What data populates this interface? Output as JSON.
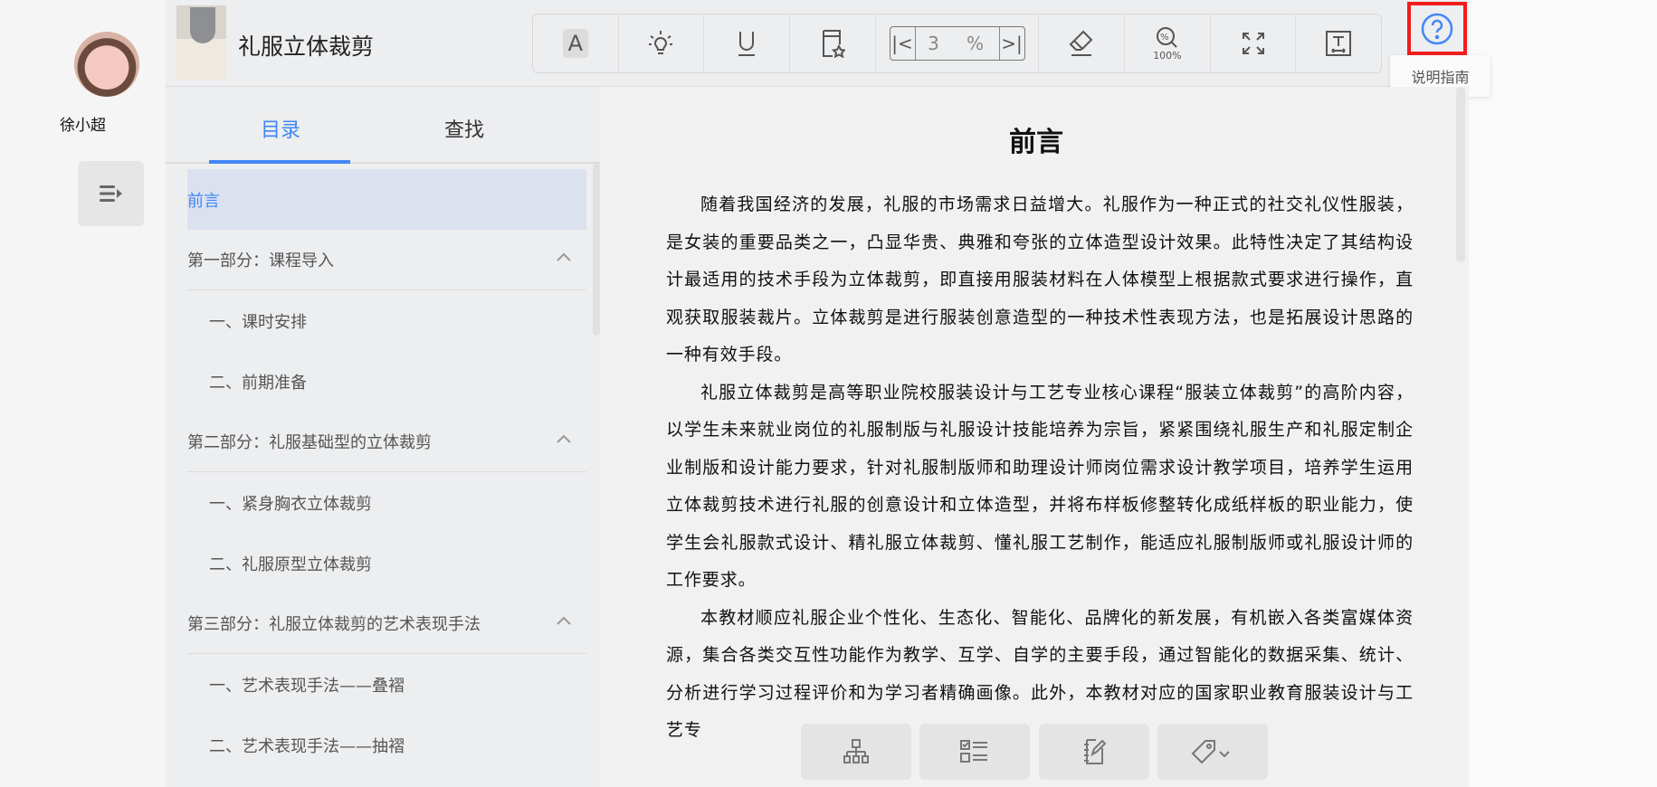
{
  "user": {
    "name": "徐小超"
  },
  "book": {
    "title": "礼服立体裁剪"
  },
  "toolbar": {
    "page": "3",
    "percent": "%",
    "zoom": "100%",
    "font_label": "A"
  },
  "help": {
    "tooltip": "说明指南"
  },
  "sidebar": {
    "tabs": [
      {
        "label": "目录",
        "active": true
      },
      {
        "label": "查找",
        "active": false
      }
    ],
    "toc": [
      {
        "label": "前言",
        "type": "cur"
      },
      {
        "label": "第一部分：课程导入",
        "type": "sec"
      },
      {
        "label": "一、课时安排",
        "type": "sub"
      },
      {
        "label": "二、前期准备",
        "type": "sub"
      },
      {
        "label": "第二部分：礼服基础型的立体裁剪",
        "type": "sec"
      },
      {
        "label": "一、紧身胸衣立体裁剪",
        "type": "sub"
      },
      {
        "label": "二、礼服原型立体裁剪",
        "type": "sub"
      },
      {
        "label": "第三部分：礼服立体裁剪的艺术表现手法",
        "type": "sec"
      },
      {
        "label": "一、艺术表现手法——叠褶",
        "type": "sub"
      },
      {
        "label": "二、艺术表现手法——抽褶",
        "type": "sub"
      }
    ]
  },
  "content": {
    "heading": "前言",
    "paragraphs": [
      "随着我国经济的发展，礼服的市场需求日益增大。礼服作为一种正式的社交礼仪性服装，是女装的重要品类之一，凸显华贵、典雅和夸张的立体造型设计效果。此特性决定了其结构设计最适用的技术手段为立体裁剪，即直接用服装材料在人体模型上根据款式要求进行操作，直观获取服装裁片。立体裁剪是进行服装创意造型的一种技术性表现方法，也是拓展设计思路的一种有效手段。",
      "礼服立体裁剪是高等职业院校服装设计与工艺专业核心课程“服装立体裁剪”的高阶内容，以学生未来就业岗位的礼服制版与礼服设计技能培养为宗旨，紧紧围绕礼服生产和礼服定制企业制版和设计能力要求，针对礼服制版师和助理设计师岗位需求设计教学项目，培养学生运用立体裁剪技术进行礼服的创意设计和立体造型，并将布样板修整转化成纸样板的职业能力，使学生会礼服款式设计、精礼服立体裁剪、懂礼服工艺制作，能适应礼服制版师或礼服设计师的工作要求。",
      "本教材顺应礼服企业个性化、生态化、智能化、品牌化的新发展，有机嵌入各类富媒体资源，集合各类交互性功能作为教学、互学、自学的主要手段，通过智能化的数据采集、统计、分析进行学习过程评价和为学习者精确画像。此外，本教材对应的国家职业教育服装设计与工艺专"
    ]
  },
  "colors": {
    "accent": "#4187f5",
    "highlight": "#dbe1ef",
    "help_border": "#f21d1d"
  }
}
